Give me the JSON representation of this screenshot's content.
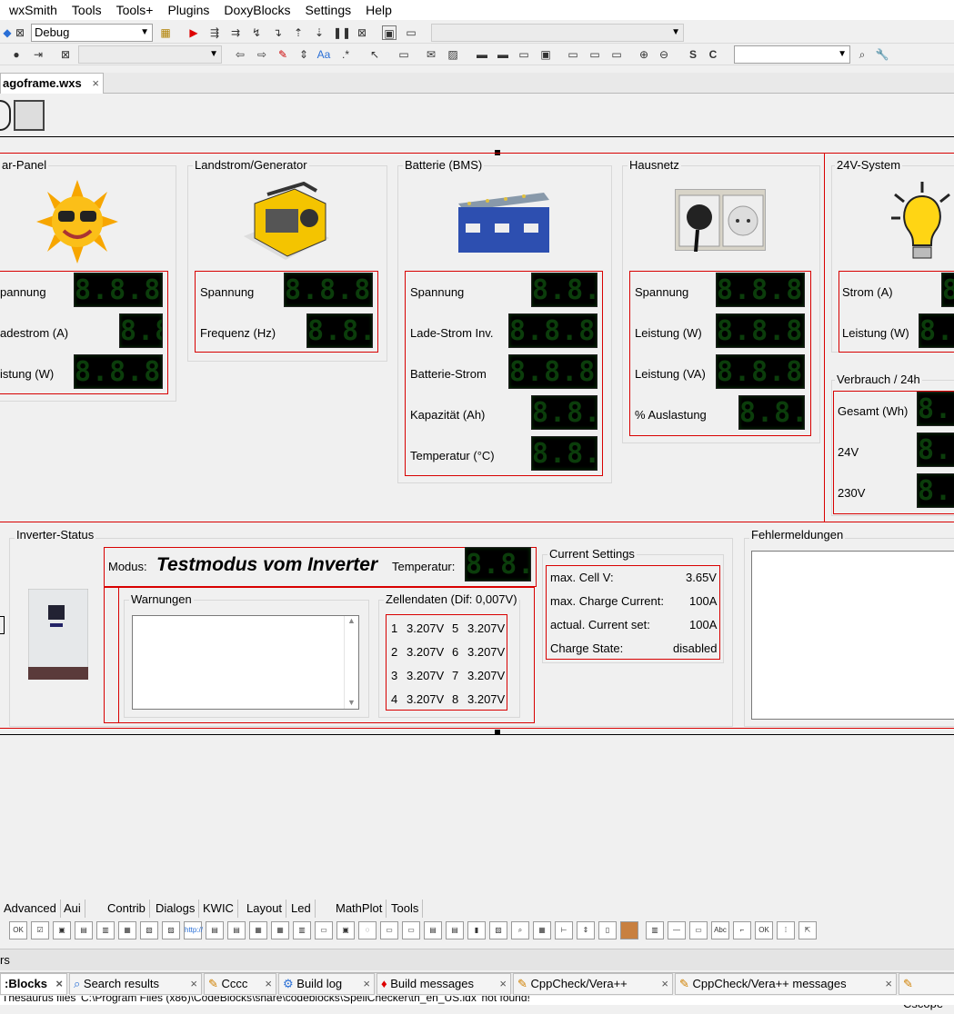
{
  "menu": [
    "wxSmith",
    "Tools",
    "Tools+",
    "Plugins",
    "DoxyBlocks",
    "Settings",
    "Help"
  ],
  "toolbar": {
    "build_target": "Debug",
    "empty_combo": ""
  },
  "editor_tab": {
    "label": "agoframe.wxs",
    "close": "×"
  },
  "panels": {
    "solar": {
      "title": "ar-Panel",
      "rows": [
        {
          "label": "pannung",
          "value": "8.8.8.8"
        },
        {
          "label": "adestrom (A)",
          "value": "8.8"
        },
        {
          "label": "istung (W)",
          "value": "8.8.8.8"
        }
      ]
    },
    "landstrom": {
      "title": "Landstrom/Generator",
      "rows": [
        {
          "label": "Spannung",
          "value": "8.8.8.8"
        },
        {
          "label": "Frequenz (Hz)",
          "value": "8.8.8"
        }
      ]
    },
    "batterie": {
      "title": "Batterie (BMS)",
      "rows": [
        {
          "label": "Spannung",
          "value": "8.8.8"
        },
        {
          "label": "Lade-Strom Inv.",
          "value": "8.8.8.8"
        },
        {
          "label": "Batterie-Strom",
          "value": "8.8.8.8"
        },
        {
          "label": "Kapazität (Ah)",
          "value": "8.8.8"
        },
        {
          "label": "Temperatur (°C)",
          "value": "8.8.8"
        }
      ]
    },
    "hausnetz": {
      "title": "Hausnetz",
      "rows": [
        {
          "label": "Spannung",
          "value": "8.8.8.8"
        },
        {
          "label": "Leistung (W)",
          "value": "8.8.8.8"
        },
        {
          "label": "Leistung (VA)",
          "value": "8.8.8.8"
        },
        {
          "label": "% Auslastung",
          "value": "8.8.8"
        }
      ]
    },
    "v24": {
      "title": "24V-System",
      "rows": [
        {
          "label": "Strom (A)",
          "value": "8"
        },
        {
          "label": "Leistung (W)",
          "value": "8.8"
        }
      ]
    },
    "verbrauch": {
      "title": "Verbrauch / 24h",
      "rows": [
        {
          "label": "Gesamt (Wh)",
          "value": "8.8"
        },
        {
          "label": "24V",
          "value": "8.8"
        },
        {
          "label": "230V",
          "value": "8.8"
        }
      ]
    }
  },
  "inverter": {
    "title": "Inverter-Status",
    "modus_label": "Modus:",
    "modus_value": "Testmodus vom Inverter",
    "temp_label": "Temperatur:",
    "temp_value": "8.8.8"
  },
  "warnungen": {
    "title": "Warnungen"
  },
  "zellen": {
    "title": "Zellendaten (Dif: 0,007V)",
    "cells": [
      {
        "n": "1",
        "v": "3.207V",
        "n2": "5",
        "v2": "3.207V"
      },
      {
        "n": "2",
        "v": "3.207V",
        "n2": "6",
        "v2": "3.207V"
      },
      {
        "n": "3",
        "v": "3.207V",
        "n2": "7",
        "v2": "3.207V"
      },
      {
        "n": "4",
        "v": "3.207V",
        "n2": "8",
        "v2": "3.207V"
      }
    ]
  },
  "settings": {
    "title": "Current Settings",
    "rows": [
      {
        "label": "max. Cell V:",
        "value": "3.65V"
      },
      {
        "label": "max. Charge Current:",
        "value": "100A"
      },
      {
        "label": "actual. Current set:",
        "value": "100A"
      },
      {
        "label": "Charge State:",
        "value": "disabled"
      }
    ]
  },
  "fehler": {
    "title": "Fehlermeldungen"
  },
  "palette_tabs": [
    "Advanced",
    "Aui",
    "Contrib",
    "Dialogs",
    "KWIC",
    "Layout",
    "Led",
    "MathPlot",
    "Tools"
  ],
  "palette_icon_text": {
    "ok": "OK",
    "abc": "Abc",
    "http": "http://"
  },
  "logpanel": {
    "title": "rs"
  },
  "log_tabs": [
    ":Blocks",
    "Search results",
    "Cccc",
    "Build log",
    "Build messages",
    "CppCheck/Vera++",
    "CppCheck/Vera++ messages",
    "Cscope"
  ],
  "status_text": "Thesaurus files 'C:\\Program Files (x86)\\CodeBlocks\\share\\codeblocks\\SpellChecker\\th_en_US.idx' not found!",
  "colors": {
    "frame_red": "#d80000",
    "led_bg": "#000000"
  }
}
